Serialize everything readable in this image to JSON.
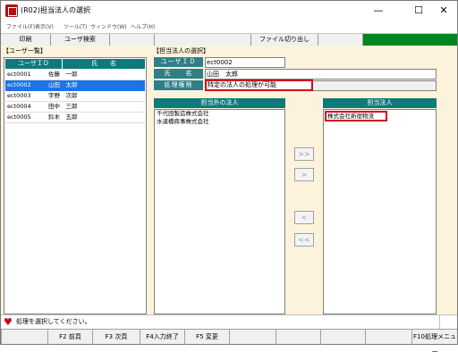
{
  "window": {
    "title": "(R02)担当法人の選択",
    "minimize": "—",
    "maximize": "☐",
    "close": "✕"
  },
  "menu": [
    "ファイル(F)",
    "表示(V)",
    "ツール(T)",
    "ウィンドウ(W)",
    "ヘルプ(H)"
  ],
  "toolbar": {
    "print": "印刷",
    "user_search": "ユーザ検索",
    "file_switch": "ファイル切り出し"
  },
  "user_list": {
    "section_title": "【ユーザ一覧】",
    "col_id": "ユーザＩＤ",
    "col_name": "氏　　名",
    "rows": [
      {
        "id": "ect0001",
        "name": "佐藤　一郎",
        "selected": false
      },
      {
        "id": "ect0002",
        "name": "山田　太郎",
        "selected": true
      },
      {
        "id": "ect0003",
        "name": "宇野　次郎",
        "selected": false
      },
      {
        "id": "ect0004",
        "name": "田中　三郎",
        "selected": false
      },
      {
        "id": "ect0005",
        "name": "鈴木　五郎",
        "selected": false
      }
    ]
  },
  "assign": {
    "section_title": "【担当法人の選択】",
    "user_id_label": "ユーザＩＤ",
    "user_id_value": "ect0002",
    "name_label": "氏　　名",
    "name_value": "山田　太郎",
    "auth_label": "処理権限",
    "auth_value": "特定の法人の処理が可能",
    "outside_header": "担当外の法人",
    "outside_items": [
      "千代田製造株式会社",
      "水道橋商事株式会社"
    ],
    "inside_header": "担当法人",
    "inside_items": [
      "株式会社新宿物流"
    ]
  },
  "nav": {
    "add_all": ">>",
    "add": ">",
    "remove": "<",
    "remove_all": "<<"
  },
  "status": {
    "icon": "heart-icon",
    "text": "処理を選択してください。"
  },
  "fkeys": [
    "F2 前頁",
    "F3 次頁",
    "F4入力終了",
    "F5 変更",
    "F10処理メニュー"
  ],
  "colors": {
    "header_teal": "#0d7b7b",
    "selected_blue": "#1e73e6",
    "panel_bg": "#fdf3dc",
    "green": "#00861c",
    "accent_red": "#d0001e"
  }
}
